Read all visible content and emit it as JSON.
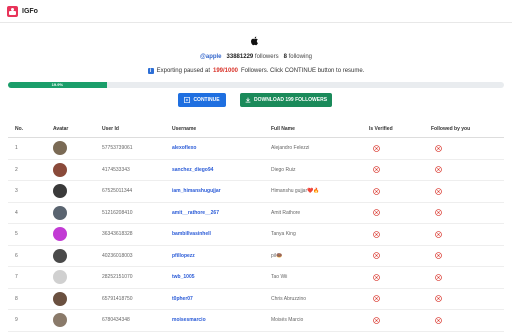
{
  "app": {
    "title": "IGFo"
  },
  "profile": {
    "username": "@apple",
    "followers_count": "33881229",
    "followers_label": "followers",
    "following_count": "8",
    "following_label": "following"
  },
  "notice": {
    "prefix": "Exporting paused at",
    "count": "199/1000",
    "suffix": "Followers. Click CONTINUE button to resume."
  },
  "progress": {
    "value_percent": 19.9,
    "label": "19.9%"
  },
  "buttons": {
    "continue_label": "CONTINUE",
    "download_label": "DOWNLOAD 199 FOLLOWERS"
  },
  "table": {
    "headers": [
      "No.",
      "Avatar",
      "User Id",
      "Username",
      "Full Name",
      "Is Verified",
      "Followed by you"
    ],
    "rows": [
      {
        "no": "1",
        "avatar_color": "#7a6a55",
        "user_id": "57753739061",
        "username": "alexoflexo",
        "full_name": "Alejandro Felezzi",
        "is_verified": "no",
        "followed": "no"
      },
      {
        "no": "2",
        "avatar_color": "#8a4a3a",
        "user_id": "4174533343",
        "username": "sanchez_diego94",
        "full_name": "Diego Ruiz",
        "is_verified": "no",
        "followed": "no"
      },
      {
        "no": "3",
        "avatar_color": "#3a3a3a",
        "user_id": "67525011344",
        "username": "iam_himanshugujjar",
        "full_name": "Himanshu gujjar❤️🔥",
        "is_verified": "no",
        "followed": "no"
      },
      {
        "no": "4",
        "avatar_color": "#5a6470",
        "user_id": "51216208410",
        "username": "amit__rathore__267",
        "full_name": "Amit Rathore",
        "is_verified": "no",
        "followed": "no"
      },
      {
        "no": "5",
        "avatar_color": "#c23bd4",
        "user_id": "36343618328",
        "username": "bambillvasinhell",
        "full_name": "Tanya King",
        "is_verified": "no",
        "followed": "no"
      },
      {
        "no": "6",
        "avatar_color": "#4a4a4a",
        "user_id": "40236018003",
        "username": "pfillopezz",
        "full_name": "pil🍩",
        "is_verified": "no",
        "followed": "no"
      },
      {
        "no": "7",
        "avatar_color": "#d0d0d0",
        "user_id": "28252151070",
        "username": "twb_1005",
        "full_name": "Tao Wii",
        "is_verified": "no",
        "followed": "no"
      },
      {
        "no": "8",
        "avatar_color": "#6a5040",
        "user_id": "65791418750",
        "username": "t0pher07",
        "full_name": "Chris Abruzzino",
        "is_verified": "no",
        "followed": "no"
      },
      {
        "no": "9",
        "avatar_color": "#8a7a6a",
        "user_id": "6780434348",
        "username": "moisesmarcio",
        "full_name": "Moisés Marcio",
        "is_verified": "no",
        "followed": "no"
      }
    ]
  },
  "colors": {
    "accent_blue": "#1f6fe0",
    "download_green": "#1a8a5a",
    "progress_green": "#1a9e6a",
    "status_red": "#d9342b"
  },
  "icons": {
    "verified": "x-circle-icon",
    "followed": "x-circle-icon",
    "continue": "play-icon",
    "download": "download-icon",
    "brand": "apple-logo-icon"
  }
}
